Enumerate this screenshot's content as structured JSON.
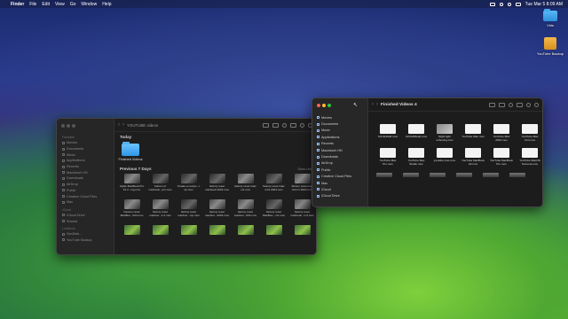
{
  "menubar": {
    "apple": "",
    "items": [
      "Finder",
      "File",
      "Edit",
      "View",
      "Go",
      "Window",
      "Help"
    ],
    "clock": "Tue Mar 5  8:09 AM"
  },
  "desktop": {
    "icons": [
      {
        "label": "Vids",
        "kind": "folder"
      },
      {
        "label": "YouTube Backup",
        "kind": "drive"
      }
    ]
  },
  "window1": {
    "title": "YOUTUBE videos",
    "sidebar": [
      {
        "heading": "Favorites",
        "items": [
          "Movies",
          "Documents",
          "Music",
          "Applications",
          "Recents",
          "Macintosh HD",
          "Downloads",
          "AirDrop",
          "Public",
          "Creative Cloud Files",
          "Mac"
        ]
      },
      {
        "heading": "iCloud",
        "items": [
          "iCloud Drive",
          "Shared"
        ]
      },
      {
        "heading": "Locations",
        "items": [
          "SanDisk...",
          "YouTube Backup"
        ]
      }
    ],
    "today_label": "Today",
    "today_items": [
      "Finished Videos"
    ],
    "previous_label": "Previous 7 Days",
    "show_less": "Show Less",
    "files": [
      "Apple MacBook Pro 16 2...ing.mov",
      "bottom of macbook...pro.mov",
      "Create a compu...t up.mov",
      "factory reset macbook 2024.mov",
      "factory reset imac m1.mov",
      "factory reset imac mini 2024.mov",
      "factory reset mac mini in 2024.mov",
      "Factory reset MacBoo...024.mov",
      "factory reset macboo...2 2.mov",
      "factory reset macboo...mp.mov",
      "factory reset macboo...2024.mov",
      "factory reset macboo...024.mov",
      "factory reset MacBoo...m1.mov",
      "factory reset macbook...m3.mov",
      "",
      "",
      "",
      "",
      "",
      "",
      ""
    ]
  },
  "window2": {
    "title": "Finished Videos 4",
    "sidebar": [
      "Movies",
      "Documents",
      "Music",
      "Applications",
      "Recents",
      "Macintosh HD",
      "Downloads",
      "AirDrop",
      "Public",
      "Creative Cloud Files",
      "Mac",
      "iCloud",
      "iCloud Drive"
    ],
    "files": [
      "fvrtcfe4fa4f.mov",
      "fvrtrfaf23eab.mov",
      "Night light unboxing.mov",
      "YouTube Mac.mov",
      "YouTube Mac 2024.mov",
      "YouTube Mac mini.mov",
      "YouTube Mac Pro.mov",
      "YouTube Mac Studio.mov",
      "youtube mac.mov",
      "YouTube MacBook Air.mov",
      "YouTube MacBook Pro.mov",
      "YouTube MacOS Sonoma.mov"
    ]
  }
}
